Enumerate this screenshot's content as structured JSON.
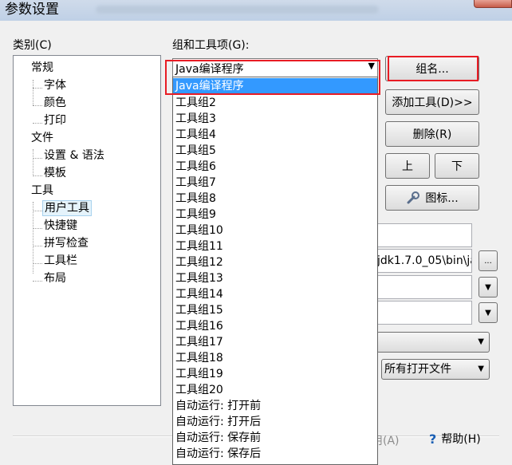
{
  "window": {
    "title": "参数设置"
  },
  "labels": {
    "category": "类别(C)",
    "group_tools": "组和工具项(G):"
  },
  "tree": {
    "general": "常规",
    "font": "字体",
    "color": "颜色",
    "print": "打印",
    "file": "文件",
    "settings_syntax": "设置 & 语法",
    "template": "模板",
    "tools": "工具",
    "user_tools": "用户工具",
    "shortcuts": "快捷键",
    "spell_check": "拼写检查",
    "toolbar": "工具栏",
    "layout": "布局"
  },
  "combo": {
    "value": "Java编译程序",
    "arrow": "▼"
  },
  "dropdown_items": [
    "Java编译程序",
    "工具组2",
    "工具组3",
    "工具组4",
    "工具组5",
    "工具组6",
    "工具组7",
    "工具组8",
    "工具组9",
    "工具组10",
    "工具组11",
    "工具组12",
    "工具组13",
    "工具组14",
    "工具组15",
    "工具组16",
    "工具组17",
    "工具组18",
    "工具组19",
    "工具组20",
    "自动运行: 打开前",
    "自动运行: 打开后",
    "自动运行: 保存前",
    "自动运行: 保存后"
  ],
  "buttons": {
    "group_name": "组名...",
    "add_tool": "添加工具(D)>>",
    "delete": "删除(R)",
    "up": "上",
    "down": "下",
    "icon": "图标...",
    "browse": "...",
    "apply": "用(A)",
    "help": "帮助(H)"
  },
  "fields": {
    "command_path": "jdk1.7.0_05\\bin\\ja"
  },
  "selects": {
    "scope": "所有打开文件",
    "arrow": "▼"
  },
  "icons": {
    "help": "?",
    "wrench": "wrench-icon"
  },
  "colors": {
    "highlight_red": "#e81c24",
    "selection_blue": "#3399ff"
  }
}
